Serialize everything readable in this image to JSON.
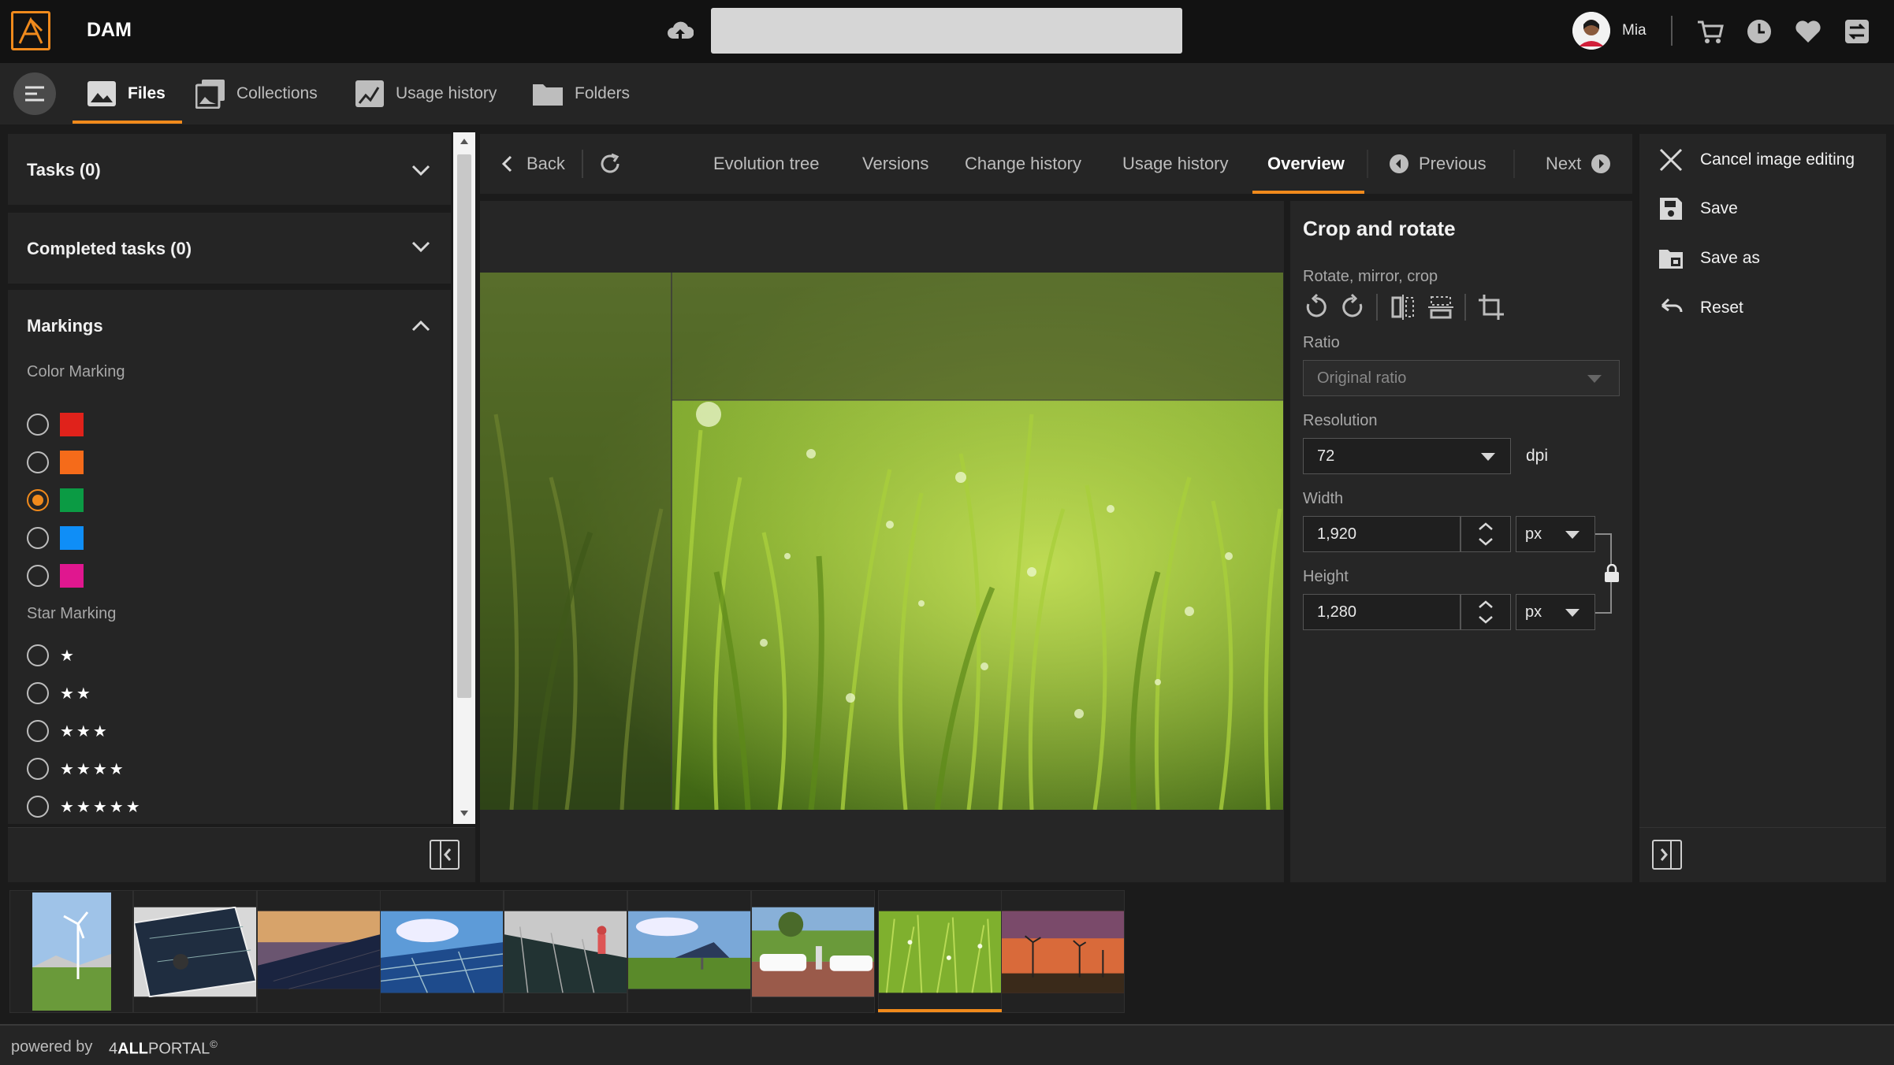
{
  "app": {
    "title": "DAM"
  },
  "user": {
    "name": "Mia"
  },
  "search": {
    "value": ""
  },
  "nav": {
    "tabs": [
      {
        "label": "Files",
        "icon": "image-icon",
        "active": true
      },
      {
        "label": "Collections",
        "icon": "images-icon"
      },
      {
        "label": "Usage history",
        "icon": "chart-image-icon"
      },
      {
        "label": "Folders",
        "icon": "folder-icon"
      }
    ]
  },
  "left_panel": {
    "tasks": "Tasks (0)",
    "completed_tasks": "Completed tasks (0)",
    "markings": "Markings",
    "color_marking_label": "Color Marking",
    "colors": [
      {
        "hex": "#e0221b",
        "checked": false
      },
      {
        "hex": "#f56b1a",
        "checked": false
      },
      {
        "hex": "#0b9b44",
        "checked": true
      },
      {
        "hex": "#0f8ef7",
        "checked": false
      },
      {
        "hex": "#e0178f",
        "checked": false
      }
    ],
    "star_marking_label": "Star Marking",
    "stars": [
      "★",
      "★★",
      "★★★",
      "★★★★",
      "★★★★★"
    ]
  },
  "toolbar": {
    "back": "Back",
    "tabs": [
      "Evolution tree",
      "Versions",
      "Change history",
      "Usage history",
      "Overview"
    ],
    "active_tab": "Overview",
    "previous": "Previous",
    "next": "Next"
  },
  "crop_panel": {
    "title": "Crop and rotate",
    "rotate_label": "Rotate, mirror, crop",
    "ratio_label": "Ratio",
    "ratio_value": "Original ratio",
    "resolution_label": "Resolution",
    "resolution_value": "72",
    "resolution_unit": "dpi",
    "width_label": "Width",
    "width_value": "1,920",
    "width_unit": "px",
    "height_label": "Height",
    "height_value": "1,280",
    "height_unit": "px"
  },
  "right_panel": {
    "cancel": "Cancel image editing",
    "save": "Save",
    "save_as": "Save as",
    "reset": "Reset"
  },
  "filmstrip": {
    "thumbs": [
      "wind-turbine",
      "solar-install",
      "solar-sunset",
      "solar-sky",
      "solar-worker",
      "solar-field",
      "ev-charging",
      "grass",
      "wind-sunset"
    ],
    "selected_index": 7
  },
  "footer": {
    "powered_by": "powered by",
    "brand_prefix": "4",
    "brand_bold": "ALL",
    "brand_suffix": "PORTAL",
    "brand_mark": "©"
  },
  "colors": {
    "accent": "#f08a1c",
    "background": "#1b1b1b",
    "panel": "#252525"
  }
}
